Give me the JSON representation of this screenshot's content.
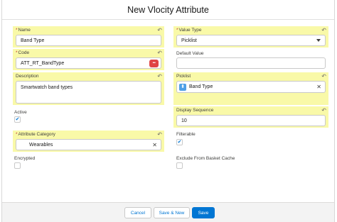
{
  "modal": {
    "title": "New Vlocity Attribute"
  },
  "fields": {
    "name": {
      "label": "Name",
      "required_mark": "*",
      "value": "Band Type"
    },
    "code": {
      "label": "Code",
      "required_mark": "*",
      "value": "ATT_RT_BandType",
      "badge": "•••"
    },
    "description": {
      "label": "Description",
      "value": "Smartwatch band types"
    },
    "active": {
      "label": "Active",
      "checked": "✔"
    },
    "attribute_category": {
      "label": "Attribute Category",
      "required_mark": "*",
      "value": "Wearables",
      "clear": "✕"
    },
    "encrypted": {
      "label": "Encrypted"
    },
    "value_type": {
      "label": "Value Type",
      "required_mark": "*",
      "value": "Picklist"
    },
    "default_value": {
      "label": "Default Value",
      "value": ""
    },
    "picklist": {
      "label": "Picklist",
      "value": "Band Type",
      "clear": "✕"
    },
    "display_sequence": {
      "label": "Display Sequence",
      "value": "10"
    },
    "filterable": {
      "label": "Filterable",
      "checked": "✔"
    },
    "exclude_from_basket_cache": {
      "label": "Exclude From Basket Cache"
    }
  },
  "icons": {
    "undo": "↶",
    "picklist_icon": "⬍"
  },
  "colors": {
    "highlight": "#f9f9a8",
    "brand": "#0176d3"
  },
  "footer": {
    "cancel": "Cancel",
    "save_new": "Save & New",
    "save": "Save"
  }
}
